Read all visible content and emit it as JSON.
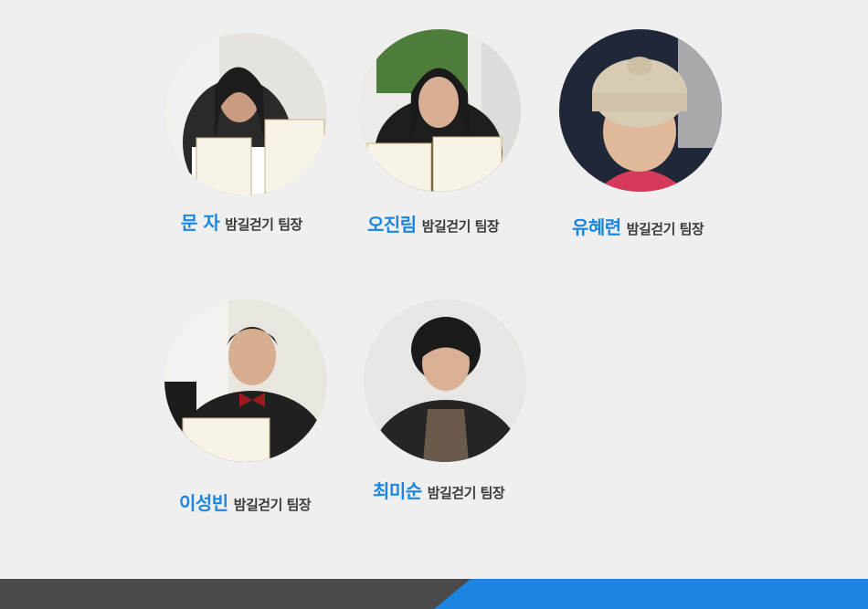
{
  "members": [
    {
      "name": "문 자",
      "role": "밤길걷기 팀장",
      "photo_icon": "person-photo-icon"
    },
    {
      "name": "오진림",
      "role": "밤길걷기 팀장",
      "photo_icon": "person-photo-icon"
    },
    {
      "name": "유혜련",
      "role": "밤길걷기 팀장",
      "photo_icon": "person-photo-icon"
    },
    {
      "name": "이성빈",
      "role": "밤길걷기 팀장",
      "photo_icon": "person-photo-icon"
    },
    {
      "name": "최미순",
      "role": "밤길걷기 팀장",
      "photo_icon": "person-photo-icon"
    }
  ],
  "colors": {
    "background": "#efefef",
    "name_accent": "#1a86e0",
    "role_text": "#3a3a3a",
    "footer_dark": "#4a4a4a",
    "footer_blue": "#1a86e0"
  }
}
